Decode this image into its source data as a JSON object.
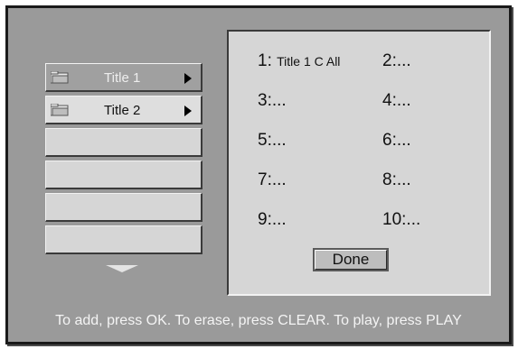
{
  "titles_list": [
    {
      "label": "Title 1",
      "state": "selected",
      "icon": "folder-icon"
    },
    {
      "label": "Title 2",
      "state": "focused",
      "icon": "folder-icon"
    },
    {
      "label": ""
    },
    {
      "label": ""
    },
    {
      "label": ""
    },
    {
      "label": ""
    }
  ],
  "program_slots": [
    {
      "number": "1:",
      "value": "Title 1 C All"
    },
    {
      "number": "2:",
      "value": "..."
    },
    {
      "number": "3:",
      "value": "..."
    },
    {
      "number": "4:",
      "value": "..."
    },
    {
      "number": "5:",
      "value": "..."
    },
    {
      "number": "6:",
      "value": "..."
    },
    {
      "number": "7:",
      "value": "..."
    },
    {
      "number": "8:",
      "value": "..."
    },
    {
      "number": "9:",
      "value": "..."
    },
    {
      "number": "10:",
      "value": "..."
    }
  ],
  "done_label": "Done",
  "help_text": "To add, press OK. To erase, press CLEAR. To play, press PLAY",
  "colors": {
    "background": "#9a9a9a",
    "panel": "#d6d6d6",
    "selected_item": "#a0a0a0",
    "help_text": "#f4f4f4"
  }
}
